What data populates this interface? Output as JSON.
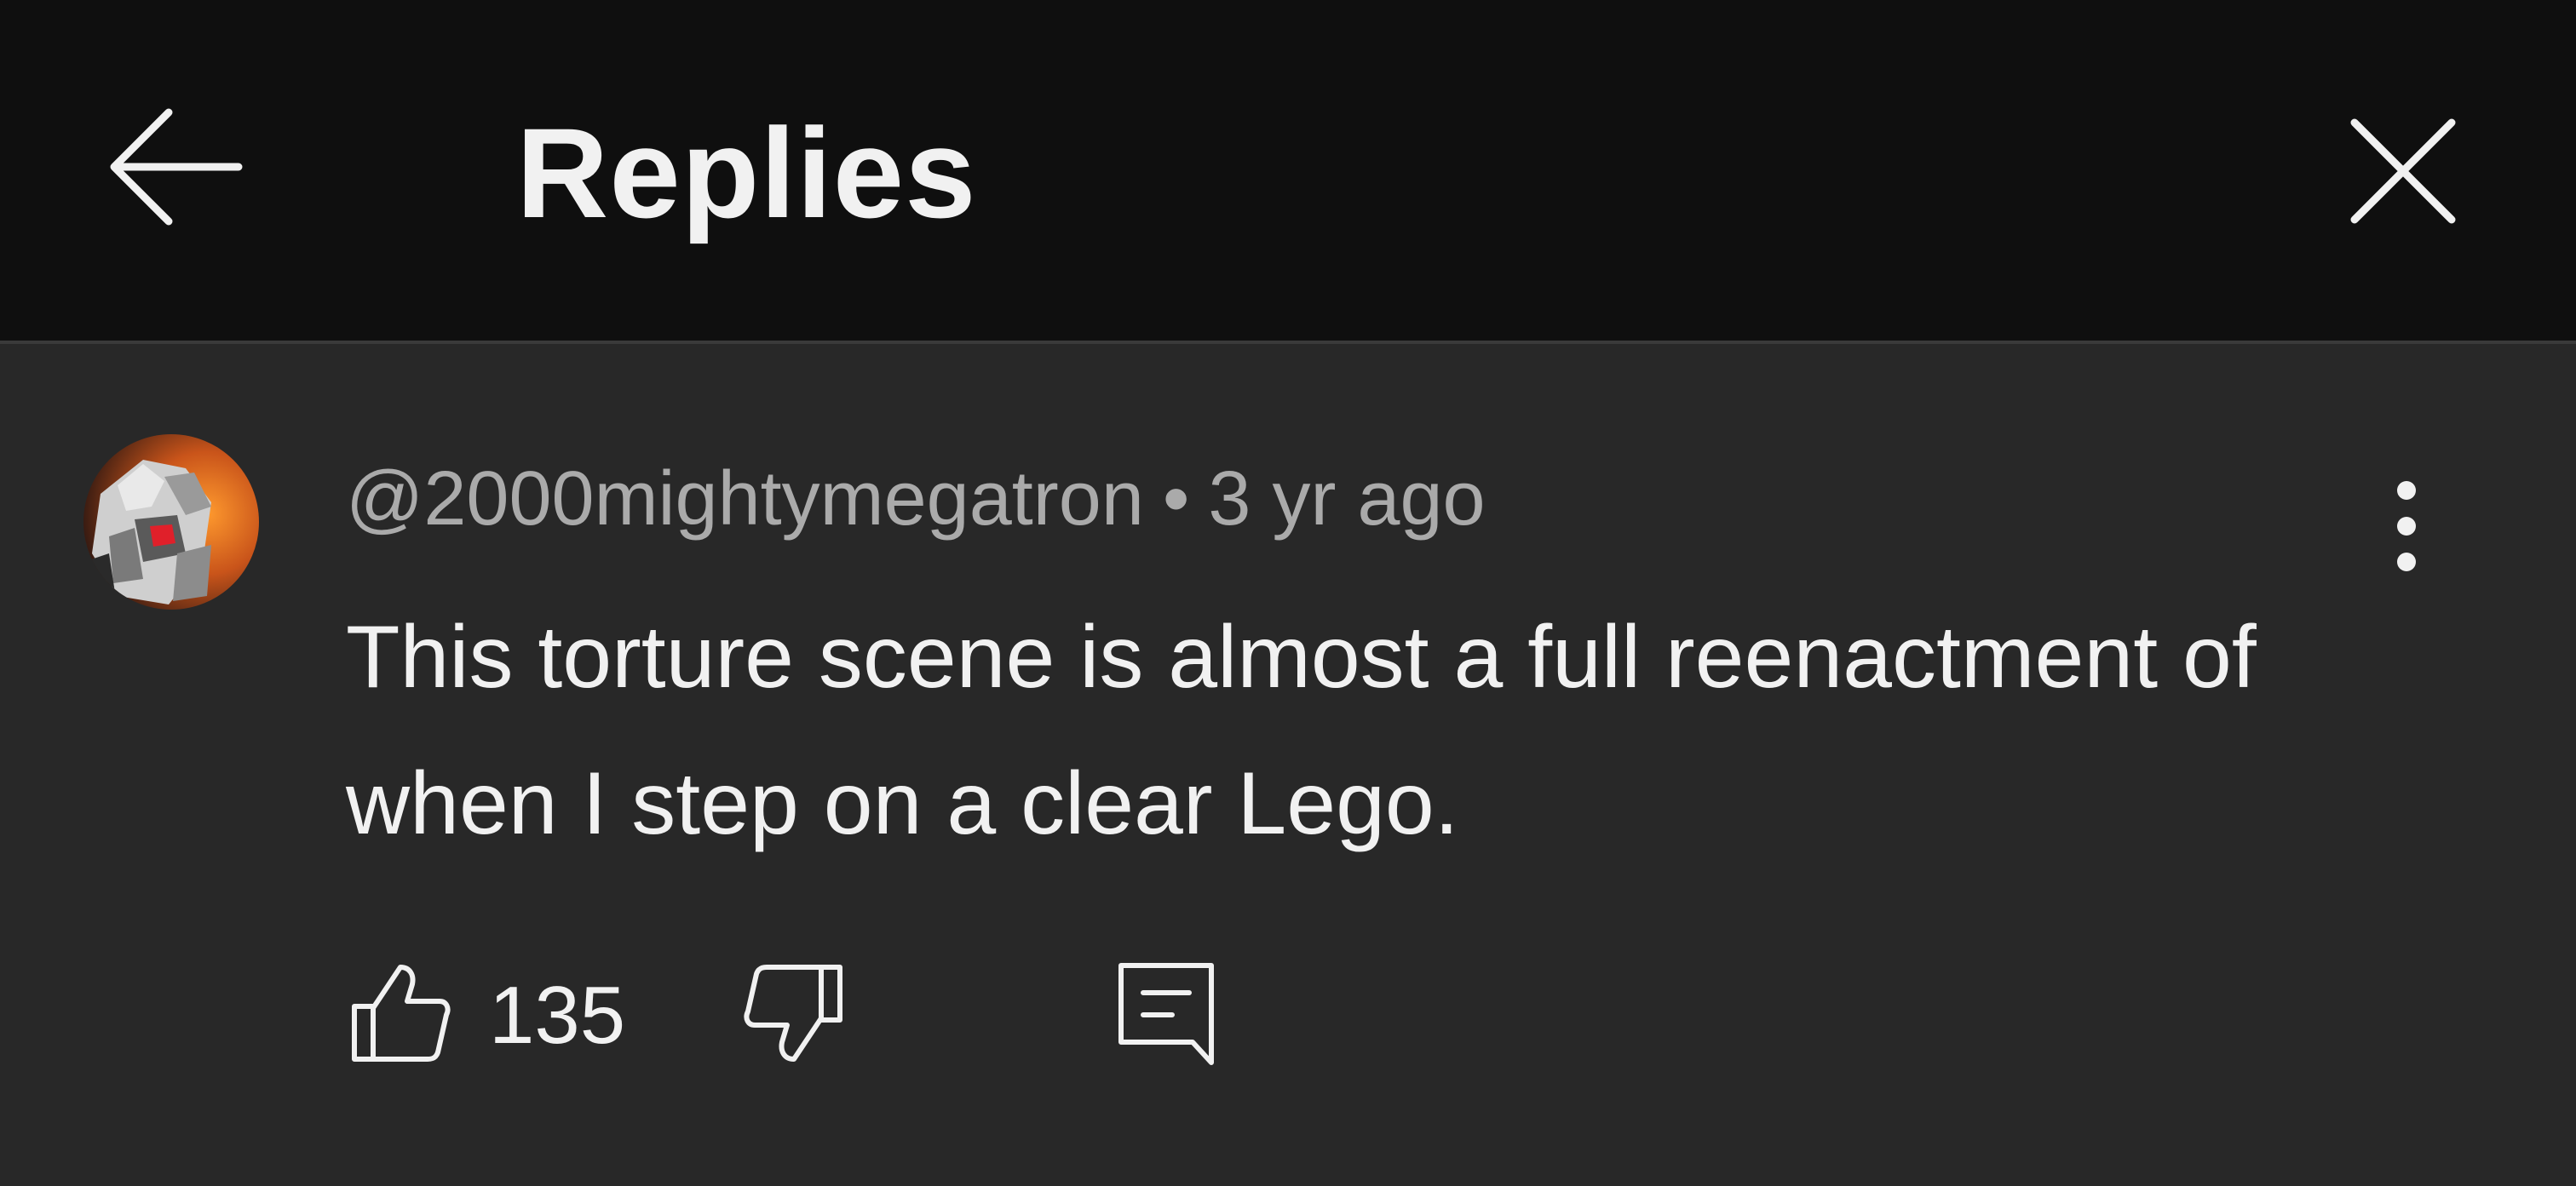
{
  "header": {
    "title": "Replies",
    "back_icon": "arrow-left-icon",
    "close_icon": "close-icon"
  },
  "comment": {
    "author": "@2000mightymegatron",
    "separator": "•",
    "time": "3 yr ago",
    "text": "This torture scene is almost a full reenactment of when I step on a clear Lego.",
    "like_count": "135",
    "avatar_icon": "avatar",
    "menu_icon": "more-vertical-icon",
    "like_icon": "thumbs-up-icon",
    "dislike_icon": "thumbs-down-icon",
    "reply_icon": "reply-comment-icon"
  },
  "colors": {
    "header_bg": "#0f0f0f",
    "body_bg": "#282828",
    "text_primary": "#f1f1f1",
    "text_secondary": "#aaaaaa"
  }
}
